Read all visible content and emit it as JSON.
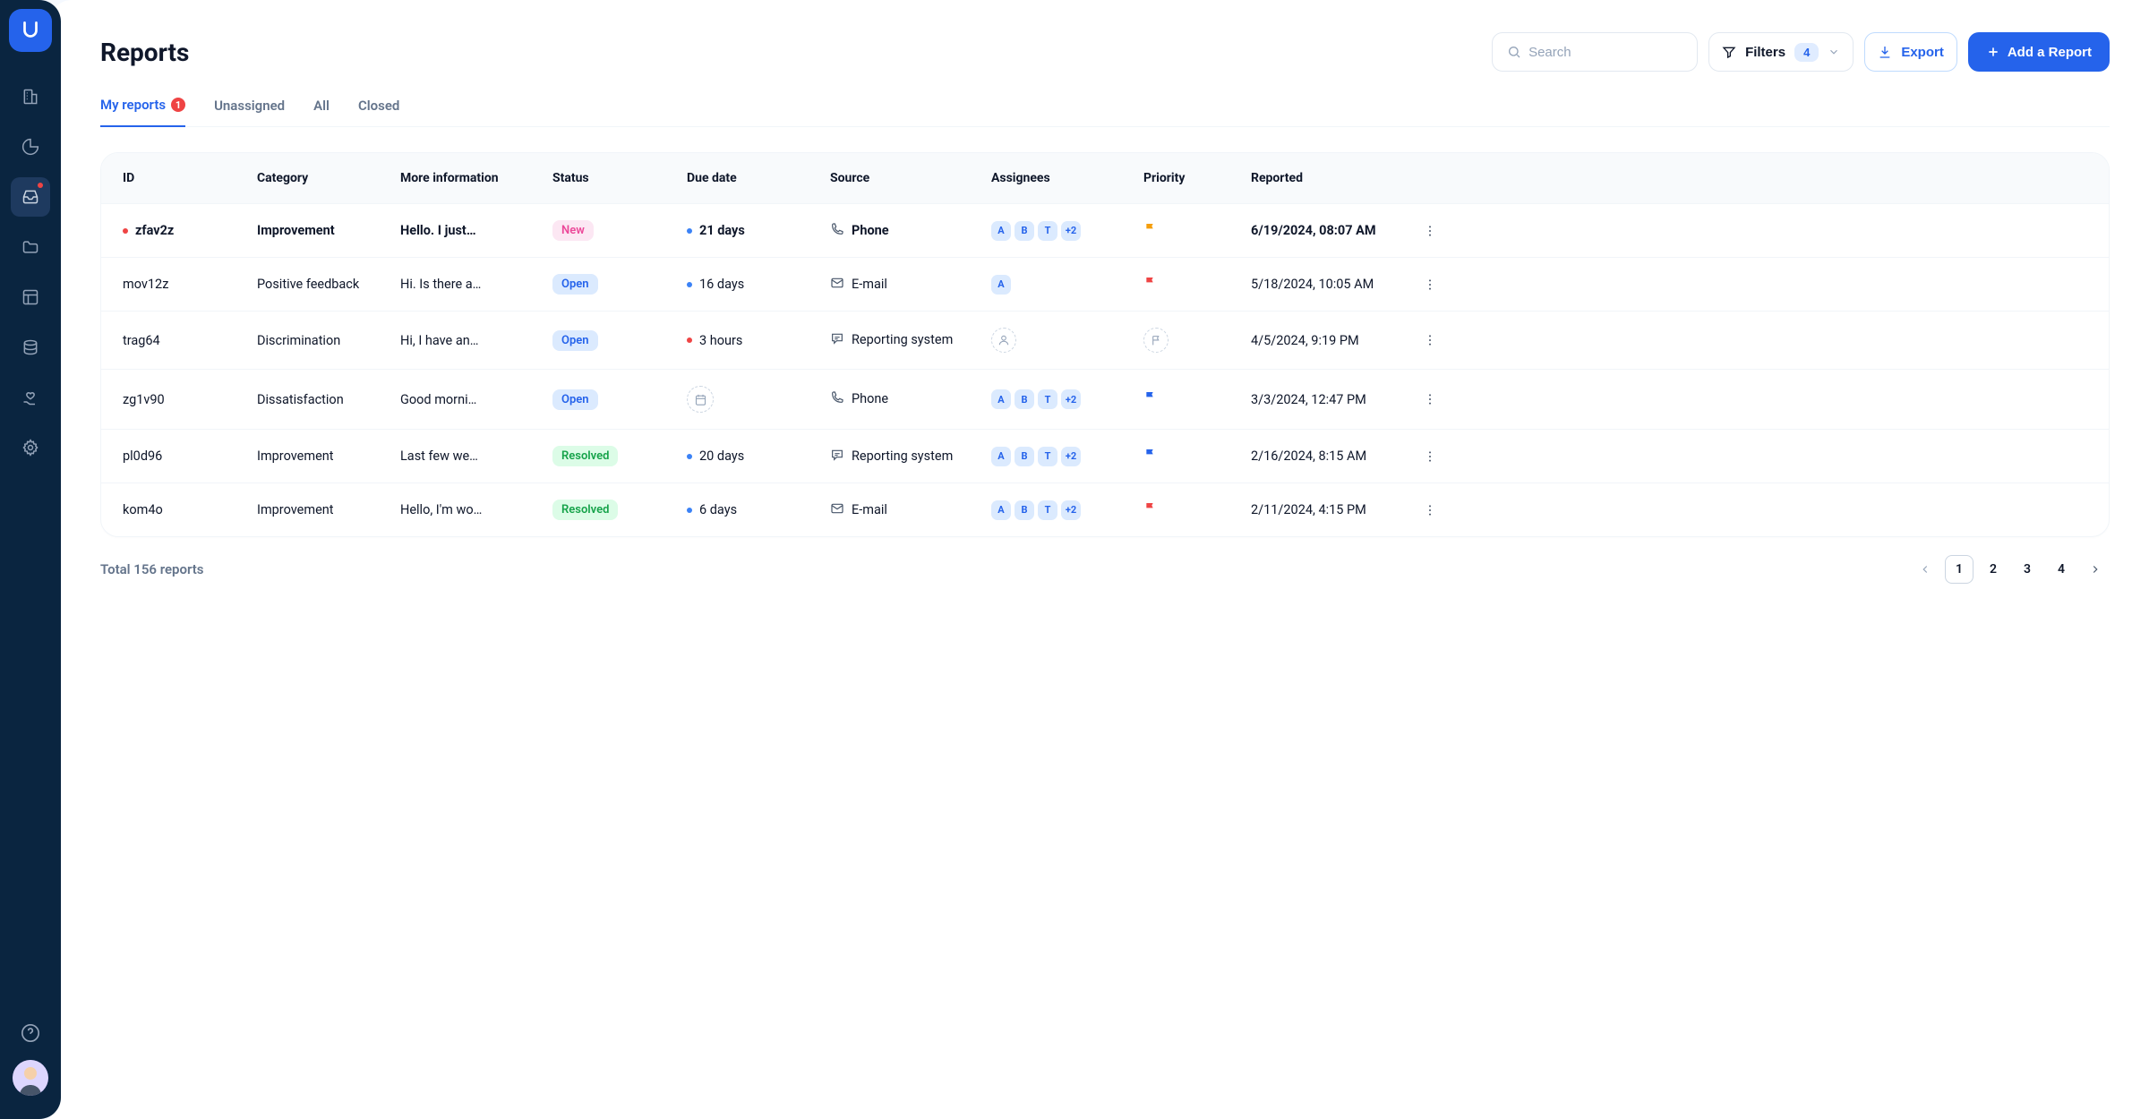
{
  "page": {
    "title": "Reports"
  },
  "search": {
    "placeholder": "Search"
  },
  "filters": {
    "label": "Filters",
    "count": "4"
  },
  "export": {
    "label": "Export"
  },
  "add": {
    "label": "Add a Report"
  },
  "tabs": [
    {
      "label": "My reports",
      "badge": "1",
      "active": true
    },
    {
      "label": "Unassigned"
    },
    {
      "label": "All"
    },
    {
      "label": "Closed"
    }
  ],
  "columns": [
    "ID",
    "Category",
    "More information",
    "Status",
    "Due date",
    "Source",
    "Assignees",
    "Priority",
    "Reported"
  ],
  "rows": [
    {
      "unread": true,
      "id": "zfav2z",
      "category": "Improvement",
      "info": "Hello. I just…",
      "status": "New",
      "status_type": "new",
      "due": "21 days",
      "due_dot": "blue",
      "source": "Phone",
      "source_icon": "phone",
      "assignees": [
        "A",
        "B",
        "T",
        "+2"
      ],
      "priority": "orange",
      "reported": "6/19/2024, 08:07 AM"
    },
    {
      "id": "mov12z",
      "category": "Positive feedback",
      "info": "Hi. Is there a…",
      "status": "Open",
      "status_type": "open",
      "due": "16 days",
      "due_dot": "blue",
      "source": "E-mail",
      "source_icon": "mail",
      "assignees": [
        "A"
      ],
      "priority": "red",
      "reported": "5/18/2024, 10:05 AM"
    },
    {
      "id": "trag64",
      "category": "Discrimination",
      "info": "Hi, I have an…",
      "status": "Open",
      "status_type": "open",
      "due": "3 hours",
      "due_dot": "red",
      "source": "Reporting system",
      "source_icon": "chat",
      "assignees": [],
      "priority": "empty",
      "reported": "4/5/2024, 9:19 PM"
    },
    {
      "id": "zg1v90",
      "category": "Dissatisfaction",
      "info": "Good morni…",
      "status": "Open",
      "status_type": "open",
      "due": "",
      "due_dot": "empty",
      "source": "Phone",
      "source_icon": "phone",
      "assignees": [
        "A",
        "B",
        "T",
        "+2"
      ],
      "priority": "blue",
      "reported": "3/3/2024, 12:47 PM"
    },
    {
      "id": "pl0d96",
      "category": "Improvement",
      "info": "Last few we…",
      "status": "Resolved",
      "status_type": "resolved",
      "due": "20 days",
      "due_dot": "blue",
      "source": "Reporting system",
      "source_icon": "chat",
      "assignees": [
        "A",
        "B",
        "T",
        "+2"
      ],
      "priority": "blue",
      "reported": "2/16/2024, 8:15 AM"
    },
    {
      "id": "kom4o",
      "category": "Improvement",
      "info": "Hello, I'm wo…",
      "status": "Resolved",
      "status_type": "resolved",
      "due": "6 days",
      "due_dot": "blue",
      "source": "E-mail",
      "source_icon": "mail",
      "assignees": [
        "A",
        "B",
        "T",
        "+2"
      ],
      "priority": "red",
      "reported": "2/11/2024, 4:15 PM"
    }
  ],
  "footer": {
    "total": "Total 156 reports",
    "pages": [
      "1",
      "2",
      "3",
      "4"
    ],
    "active_page": "1"
  }
}
